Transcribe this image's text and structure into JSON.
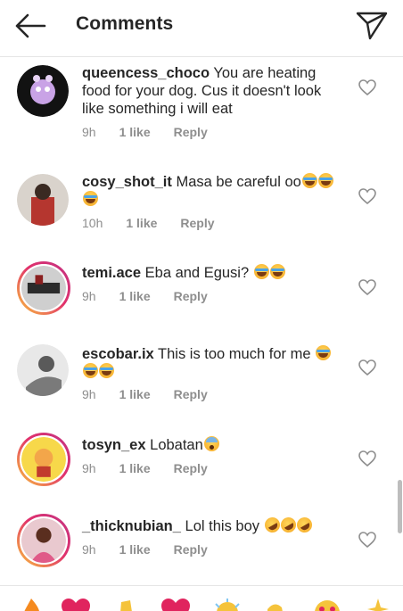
{
  "header": {
    "title": "Comments"
  },
  "comments": [
    {
      "username": "queencess_choco",
      "text": "You are heating food for your dog. Cus it doesn't look like something i will eat",
      "time": "9h",
      "likes": "1 like",
      "reply": "Reply"
    },
    {
      "username": "cosy_shot_it",
      "text": "Masa be careful oo",
      "time": "10h",
      "likes": "1 like",
      "reply": "Reply"
    },
    {
      "username": "temi.ace",
      "text": "Eba and Egusi?",
      "time": "9h",
      "likes": "1 like",
      "reply": "Reply"
    },
    {
      "username": "escobar.ix",
      "text": "This is too much for me",
      "time": "9h",
      "likes": "1 like",
      "reply": "Reply"
    },
    {
      "username": "tosyn_ex",
      "text": "Lobatan",
      "time": "9h",
      "likes": "1 like",
      "reply": "Reply"
    },
    {
      "username": "_thicknubian_",
      "text": "Lol this boy",
      "time": "9h",
      "likes": "1 like",
      "reply": "Reply"
    }
  ],
  "icons": {
    "back": "arrow-left-icon",
    "send": "paper-plane-icon",
    "like": "heart-outline-icon",
    "reactions": [
      "fire-emoji",
      "red-heart-emoji",
      "clapping-emoji",
      "heart-emoji",
      "party-emoji",
      "thumbs-emoji",
      "heart-eyes-emoji",
      "sparkle-emoji"
    ]
  },
  "colors": {
    "text": "#262626",
    "secondary": "#8e8e8e",
    "divider": "#e6e6e6"
  }
}
